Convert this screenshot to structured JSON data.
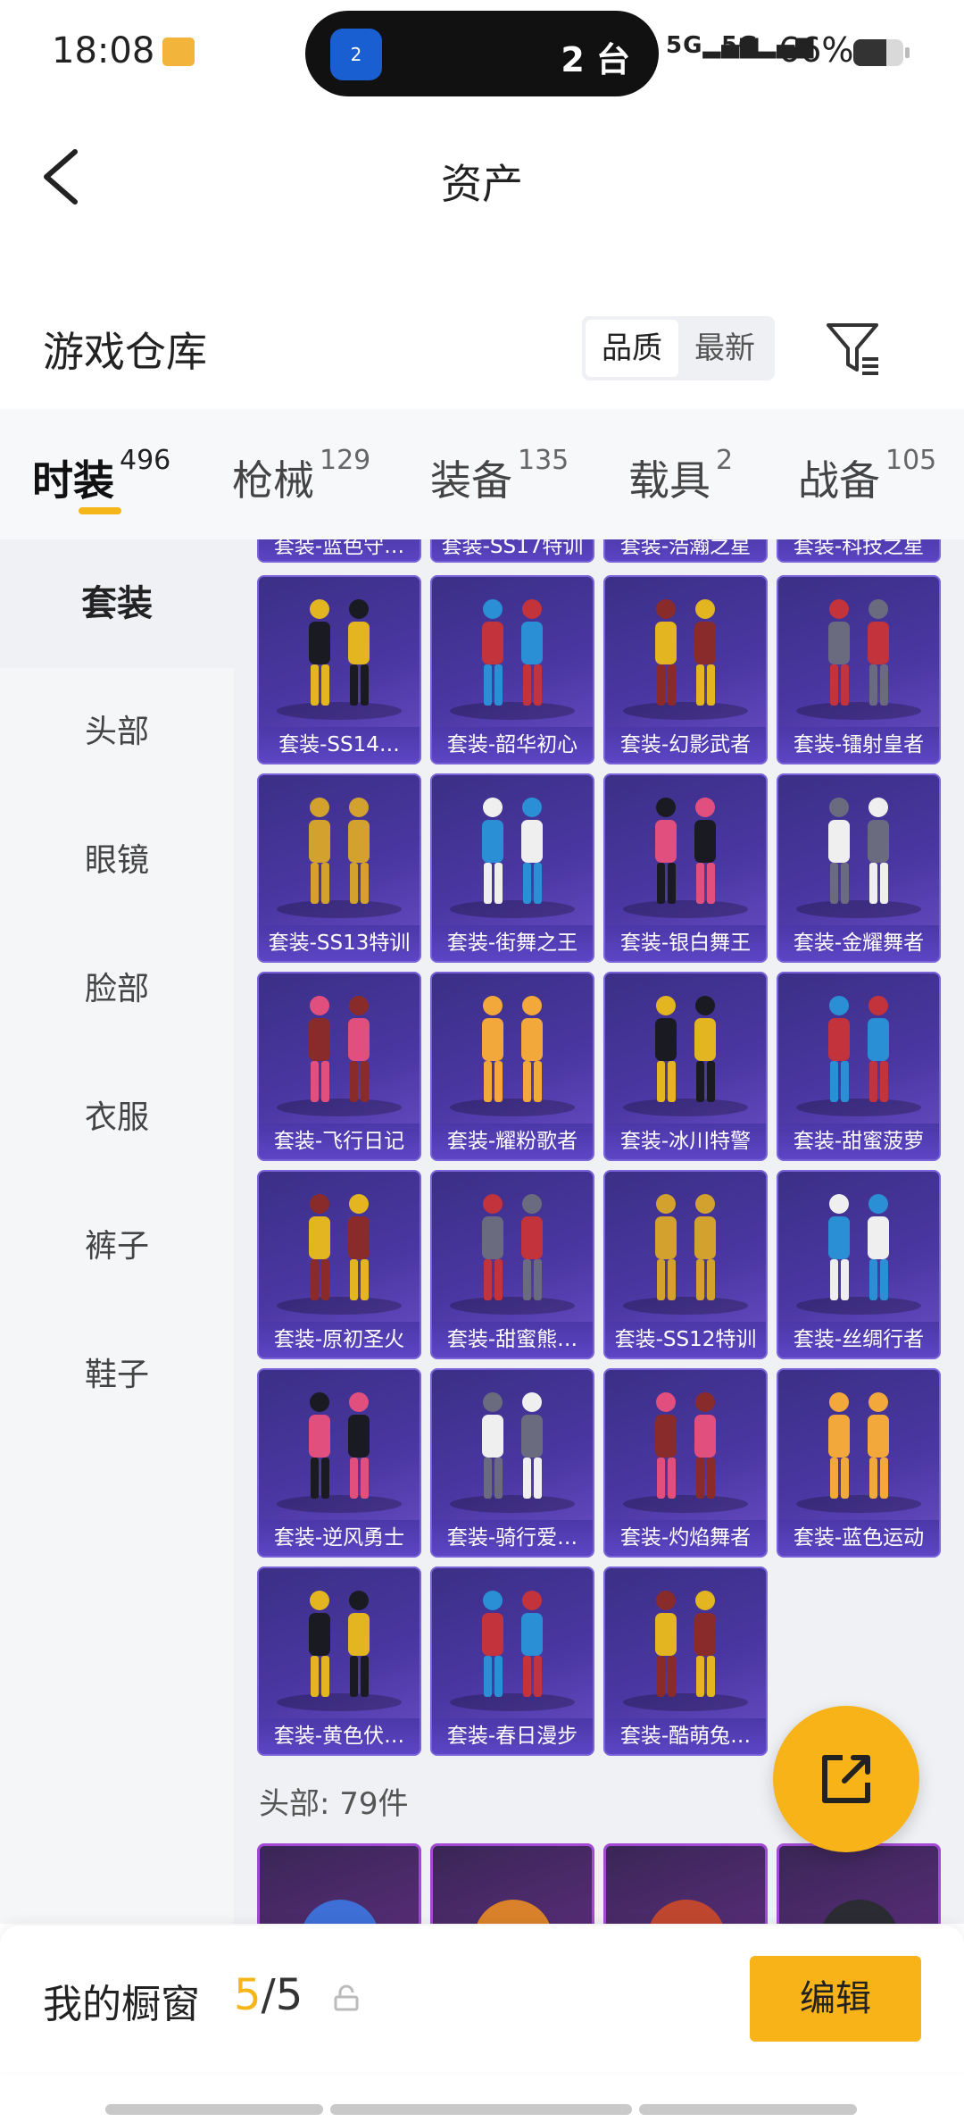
{
  "status_bar": {
    "time": "18:08",
    "island_text": "2 台",
    "island_icon_badge": "2",
    "signal_1": "5G",
    "signal_2": "5G",
    "battery_percent": "66%",
    "battery_level": 0.66
  },
  "nav": {
    "title": "资产"
  },
  "section": {
    "title": "游戏仓库",
    "sort_options": [
      "品质",
      "最新"
    ],
    "sort_active": "品质"
  },
  "tabs": [
    {
      "label": "时装",
      "count": "496"
    },
    {
      "label": "枪械",
      "count": "129"
    },
    {
      "label": "装备",
      "count": "135"
    },
    {
      "label": "载具",
      "count": "2"
    },
    {
      "label": "战备",
      "count": "105"
    }
  ],
  "sidebar": [
    {
      "label": "套装"
    },
    {
      "label": "头部"
    },
    {
      "label": "眼镜"
    },
    {
      "label": "脸部"
    },
    {
      "label": "衣服"
    },
    {
      "label": "裤子"
    },
    {
      "label": "鞋子"
    }
  ],
  "cut_cards": [
    "套装-蓝色守…",
    "套装-SS17特训",
    "套装-浩瀚之星",
    "套装-科技之星"
  ],
  "cards": [
    "套装-SS14…",
    "套装-韶华初心",
    "套装-幻影武者",
    "套装-镭射皇者",
    "套装-SS13特训",
    "套装-街舞之王",
    "套装-银白舞王",
    "套装-金耀舞者",
    "套装-飞行日记",
    "套装-耀粉歌者",
    "套装-冰川特警",
    "套装-甜蜜菠萝",
    "套装-原初圣火",
    "套装-甜蜜熊…",
    "套装-SS12特训",
    "套装-丝绸行者",
    "套装-逆风勇士",
    "套装-骑行爱…",
    "套装-灼焰舞者",
    "套装-蓝色运动",
    "套装-黄色伏…",
    "套装-春日漫步",
    "套装-酷萌兔…"
  ],
  "head_section": {
    "label": "头部: 79件"
  },
  "footer": {
    "label": "我的橱窗",
    "current": "5",
    "separator_total": "/5",
    "edit_label": "编辑"
  },
  "colors": {
    "accent": "#f7b318",
    "card_bg": "#4a37a2",
    "card_label_bg": "#5d45c4"
  }
}
